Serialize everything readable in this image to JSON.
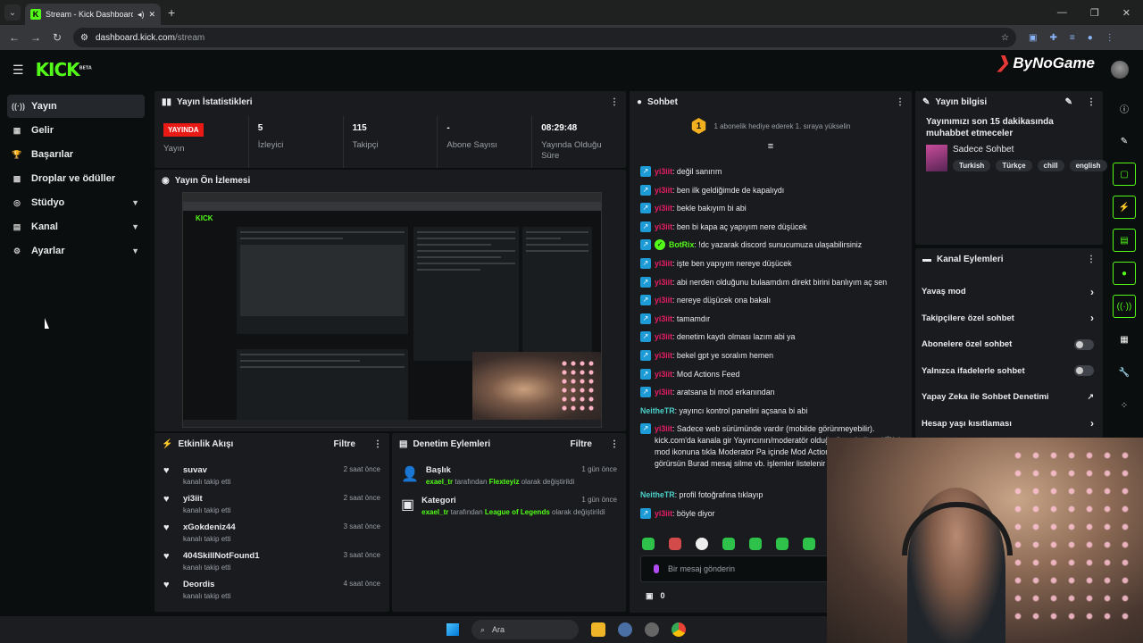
{
  "browser": {
    "tab_title": "Stream - Kick Dashboard",
    "url_host": "dashboard.kick.com",
    "url_path": "/stream"
  },
  "brand": {
    "logo": "KICK",
    "beta": "BETA",
    "watermark": "ByNoGame"
  },
  "sidebar": {
    "items": [
      {
        "label": "Yayın",
        "icon": "broadcast-icon"
      },
      {
        "label": "Gelir",
        "icon": "revenue-icon"
      },
      {
        "label": "Başarılar",
        "icon": "trophy-icon"
      },
      {
        "label": "Droplar ve ödüller",
        "icon": "gift-icon"
      },
      {
        "label": "Stüdyo",
        "icon": "studio-icon"
      },
      {
        "label": "Kanal",
        "icon": "channel-icon"
      },
      {
        "label": "Ayarlar",
        "icon": "gear-icon"
      }
    ]
  },
  "stats": {
    "title": "Yayın İstatistikleri",
    "live_badge": "YAYINDA",
    "items": [
      {
        "value": "",
        "label": "Yayın"
      },
      {
        "value": "5",
        "label": "İzleyici"
      },
      {
        "value": "115",
        "label": "Takipçi"
      },
      {
        "value": "-",
        "label": "Abone Sayısı"
      },
      {
        "value": "08:29:48",
        "label": "Yayında Olduğu Süre"
      }
    ]
  },
  "preview": {
    "title": "Yayın Ön İzlemesi"
  },
  "activity": {
    "title": "Etkinlik Akışı",
    "filter": "Filtre",
    "items": [
      {
        "name": "suvav",
        "action": "kanalı takip etti",
        "time": "2 saat önce"
      },
      {
        "name": "yi3iit",
        "action": "kanalı takip etti",
        "time": "2 saat önce"
      },
      {
        "name": "xGokdeniz44",
        "action": "kanalı takip etti",
        "time": "3 saat önce"
      },
      {
        "name": "404SkillNotFound1",
        "action": "kanalı takip etti",
        "time": "3 saat önce"
      },
      {
        "name": "Deordis",
        "action": "kanalı takip etti",
        "time": "4 saat önce"
      }
    ]
  },
  "moderation": {
    "title": "Denetim Eylemleri",
    "filter": "Filtre",
    "items": [
      {
        "name": "Başlık",
        "user": "exael_tr",
        "by": "tarafından",
        "target": "Flexteyiz",
        "action": "olarak değiştirildi",
        "time": "1 gün önce"
      },
      {
        "name": "Kategori",
        "user": "exael_tr",
        "by": "tarafından",
        "target": "League of Legends",
        "action": "olarak değiştirildi",
        "time": "1 gün önce"
      }
    ]
  },
  "chat": {
    "title": "Sohbet",
    "gift_number": "1",
    "gift_text": "1 abonelik hediye ederek 1. sıraya yükselin",
    "messages": [
      {
        "user": "yi3iit",
        "text": ": değil sanırım",
        "badge": "b"
      },
      {
        "user": "yi3iit",
        "text": ": ben ilk geldiğimde de kapalıydı",
        "badge": "b"
      },
      {
        "user": "yi3iit",
        "text": ": bekle bakıyım bi abi",
        "badge": "b"
      },
      {
        "user": "yi3iit",
        "text": ": ben bi kapa aç yapıyım nere düşücek",
        "badge": "b"
      },
      {
        "user": "BotRix",
        "text": ": !dc yazarak discord sunucumuza ulaşabilirsiniz",
        "badge": "g"
      },
      {
        "user": "yi3iit",
        "text": ": işte ben yapıyım nereye düşücek",
        "badge": "b"
      },
      {
        "user": "yi3iit",
        "text": ": abi nerden olduğunu bulaamdım direkt birini banlıyım aç sen",
        "badge": "b"
      },
      {
        "user": "yi3iit",
        "text": ": nereye düşücek ona bakalı",
        "badge": "b"
      },
      {
        "user": "yi3iit",
        "text": ": tamamdır",
        "badge": "b"
      },
      {
        "user": "yi3iit",
        "text": ": denetim kaydı olması lazım abi ya",
        "badge": "b"
      },
      {
        "user": "yi3iit",
        "text": ": bekel gpt ye soralım hemen",
        "badge": "b"
      },
      {
        "user": "yi3iit",
        "text": ": Mod Actions Feed",
        "badge": "b"
      },
      {
        "user": "yi3iit",
        "text": ": aratsana bi mod erkanından",
        "badge": "b"
      },
      {
        "user": "NeitheTR",
        "text": ": yayıncı kontrol panelini açsana bi abi",
        "badge": ""
      },
      {
        "user": "yi3iit",
        "text": ": Sadece web sürümünde vardır (mobilde görünmeyebilir). kick.com'da kanala gir Yayıncının/moderatör olduğu üstte kalkan (🛡) / mod ikonuna tıkla Moderator Pa içinde Mod Actions Feed sekmesini görürsün Burad mesaj silme vb. işlemler listelenir Kimin yaptığı ve z",
        "badge": "b"
      },
      {
        "user": "NeitheTR",
        "text": ": profil fotoğrafına tıklayıp",
        "badge": ""
      },
      {
        "user": "yi3iit",
        "text": ": böyle diyor",
        "badge": "b"
      }
    ],
    "input_placeholder": "Bir mesaj gönderin",
    "points": "0"
  },
  "stream_info": {
    "title": "Yayın bilgisi",
    "stream_title": "Yayınımızı son 15 dakikasında muhabbet etmeceler",
    "category": "Sadece Sohbet",
    "tags": [
      "Turkish",
      "Türkçe",
      "chill",
      "english"
    ]
  },
  "channel_actions": {
    "title": "Kanal Eylemleri",
    "items": [
      {
        "label": "Yavaş mod",
        "control": "chevron"
      },
      {
        "label": "Takipçilere özel sohbet",
        "control": "chevron"
      },
      {
        "label": "Abonelere özel sohbet",
        "control": "toggle"
      },
      {
        "label": "Yalnızca ifadelerle sohbet",
        "control": "toggle"
      },
      {
        "label": "Yapay Zeka ile Sohbet Denetimi",
        "control": "external"
      },
      {
        "label": "Hesap yaşı kısıtlaması",
        "control": "chevron"
      }
    ]
  },
  "taskbar": {
    "search": "Ara"
  },
  "colors": {
    "accent": "#53fc18",
    "live": "#e91916",
    "bg": "#0b0e0f",
    "panel": "#191b1f"
  }
}
